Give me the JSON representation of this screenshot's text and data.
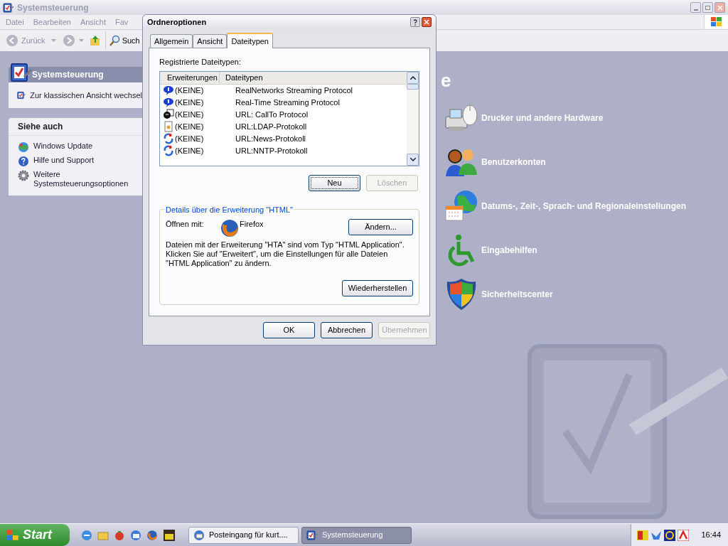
{
  "window": {
    "title": "Systemsteuerung",
    "active": false
  },
  "menu": [
    "Datei",
    "Bearbeiten",
    "Ansicht",
    "Fav"
  ],
  "toolbar": {
    "back": "Zurück",
    "search": "Such"
  },
  "sidebar": {
    "panel_title": "Systemsteuerung",
    "switch_link": "Zur klassischen Ansicht wechsel",
    "see_also_title": "Siehe auch",
    "see_also": [
      {
        "kind": "update",
        "label": "Windows Update"
      },
      {
        "kind": "help",
        "label": "Hilfe und Support"
      },
      {
        "kind": "gear",
        "label": "Weitere Systemsteuerungsoptionen"
      }
    ]
  },
  "heading_fragment": "e",
  "categories": [
    {
      "kind": "printer",
      "label": "Drucker und andere Hardware"
    },
    {
      "kind": "users",
      "label": "Benutzerkonten"
    },
    {
      "kind": "globe",
      "label": "Datums-, Zeit-, Sprach- und Regionaleinstellungen"
    },
    {
      "kind": "access",
      "label": "Eingabehilfen"
    },
    {
      "kind": "shield",
      "label": "Sicherheitscenter"
    }
  ],
  "dialog": {
    "title": "Ordneroptionen",
    "tabs": [
      {
        "label": "Allgemein",
        "selected": false
      },
      {
        "label": "Ansicht",
        "selected": false
      },
      {
        "label": "Dateitypen",
        "selected": true
      }
    ],
    "list_label": "Registrierte Dateitypen:",
    "columns": [
      "Erweiterungen",
      "Dateitypen"
    ],
    "rows": [
      {
        "kind": "speech",
        "ext": "(KEINE)",
        "type": "RealNetworks Streaming Protocol"
      },
      {
        "kind": "speech",
        "ext": "(KEINE)",
        "type": "Real-Time Streaming Protocol"
      },
      {
        "kind": "callto",
        "ext": "(KEINE)",
        "type": "URL: CallTo Protocol"
      },
      {
        "kind": "ldap",
        "ext": "(KEINE)",
        "type": "URL:LDAP-Protokoll"
      },
      {
        "kind": "news",
        "ext": "(KEINE)",
        "type": "URL:News-Protokoll"
      },
      {
        "kind": "news",
        "ext": "(KEINE)",
        "type": "URL:NNTP-Protokoll"
      }
    ],
    "list_buttons": [
      {
        "label": "Neu",
        "disabled": false,
        "focused": true
      },
      {
        "label": "Löschen",
        "disabled": true,
        "focused": false
      }
    ],
    "group_title": "Details über die Erweiterung \"HTML\"",
    "open_with_label": "Öffnen mit:",
    "program": "Firefox",
    "change_button": {
      "label": "Ändern...",
      "disabled": false
    },
    "description": "Dateien mit der Erweiterung \"HTA\" sind vom Typ \"HTML Application\". Klicken Sie auf \"Erweitert\", um die Einstellungen für alle Dateien \"HTML Application\" zu ändern.",
    "restore_button": {
      "label": "Wiederherstellen",
      "disabled": false
    },
    "footer_buttons": [
      {
        "label": "OK",
        "disabled": false
      },
      {
        "label": "Abbrechen",
        "disabled": false
      },
      {
        "label": "Übernehmen",
        "disabled": true
      }
    ]
  },
  "taskbar": {
    "start": "Start",
    "tasks": [
      {
        "kind": "mail",
        "label": "Posteingang für kurt....",
        "selected": false
      },
      {
        "kind": "panel",
        "label": "Systemsteuerung",
        "selected": true
      }
    ],
    "clock": "16:44"
  }
}
